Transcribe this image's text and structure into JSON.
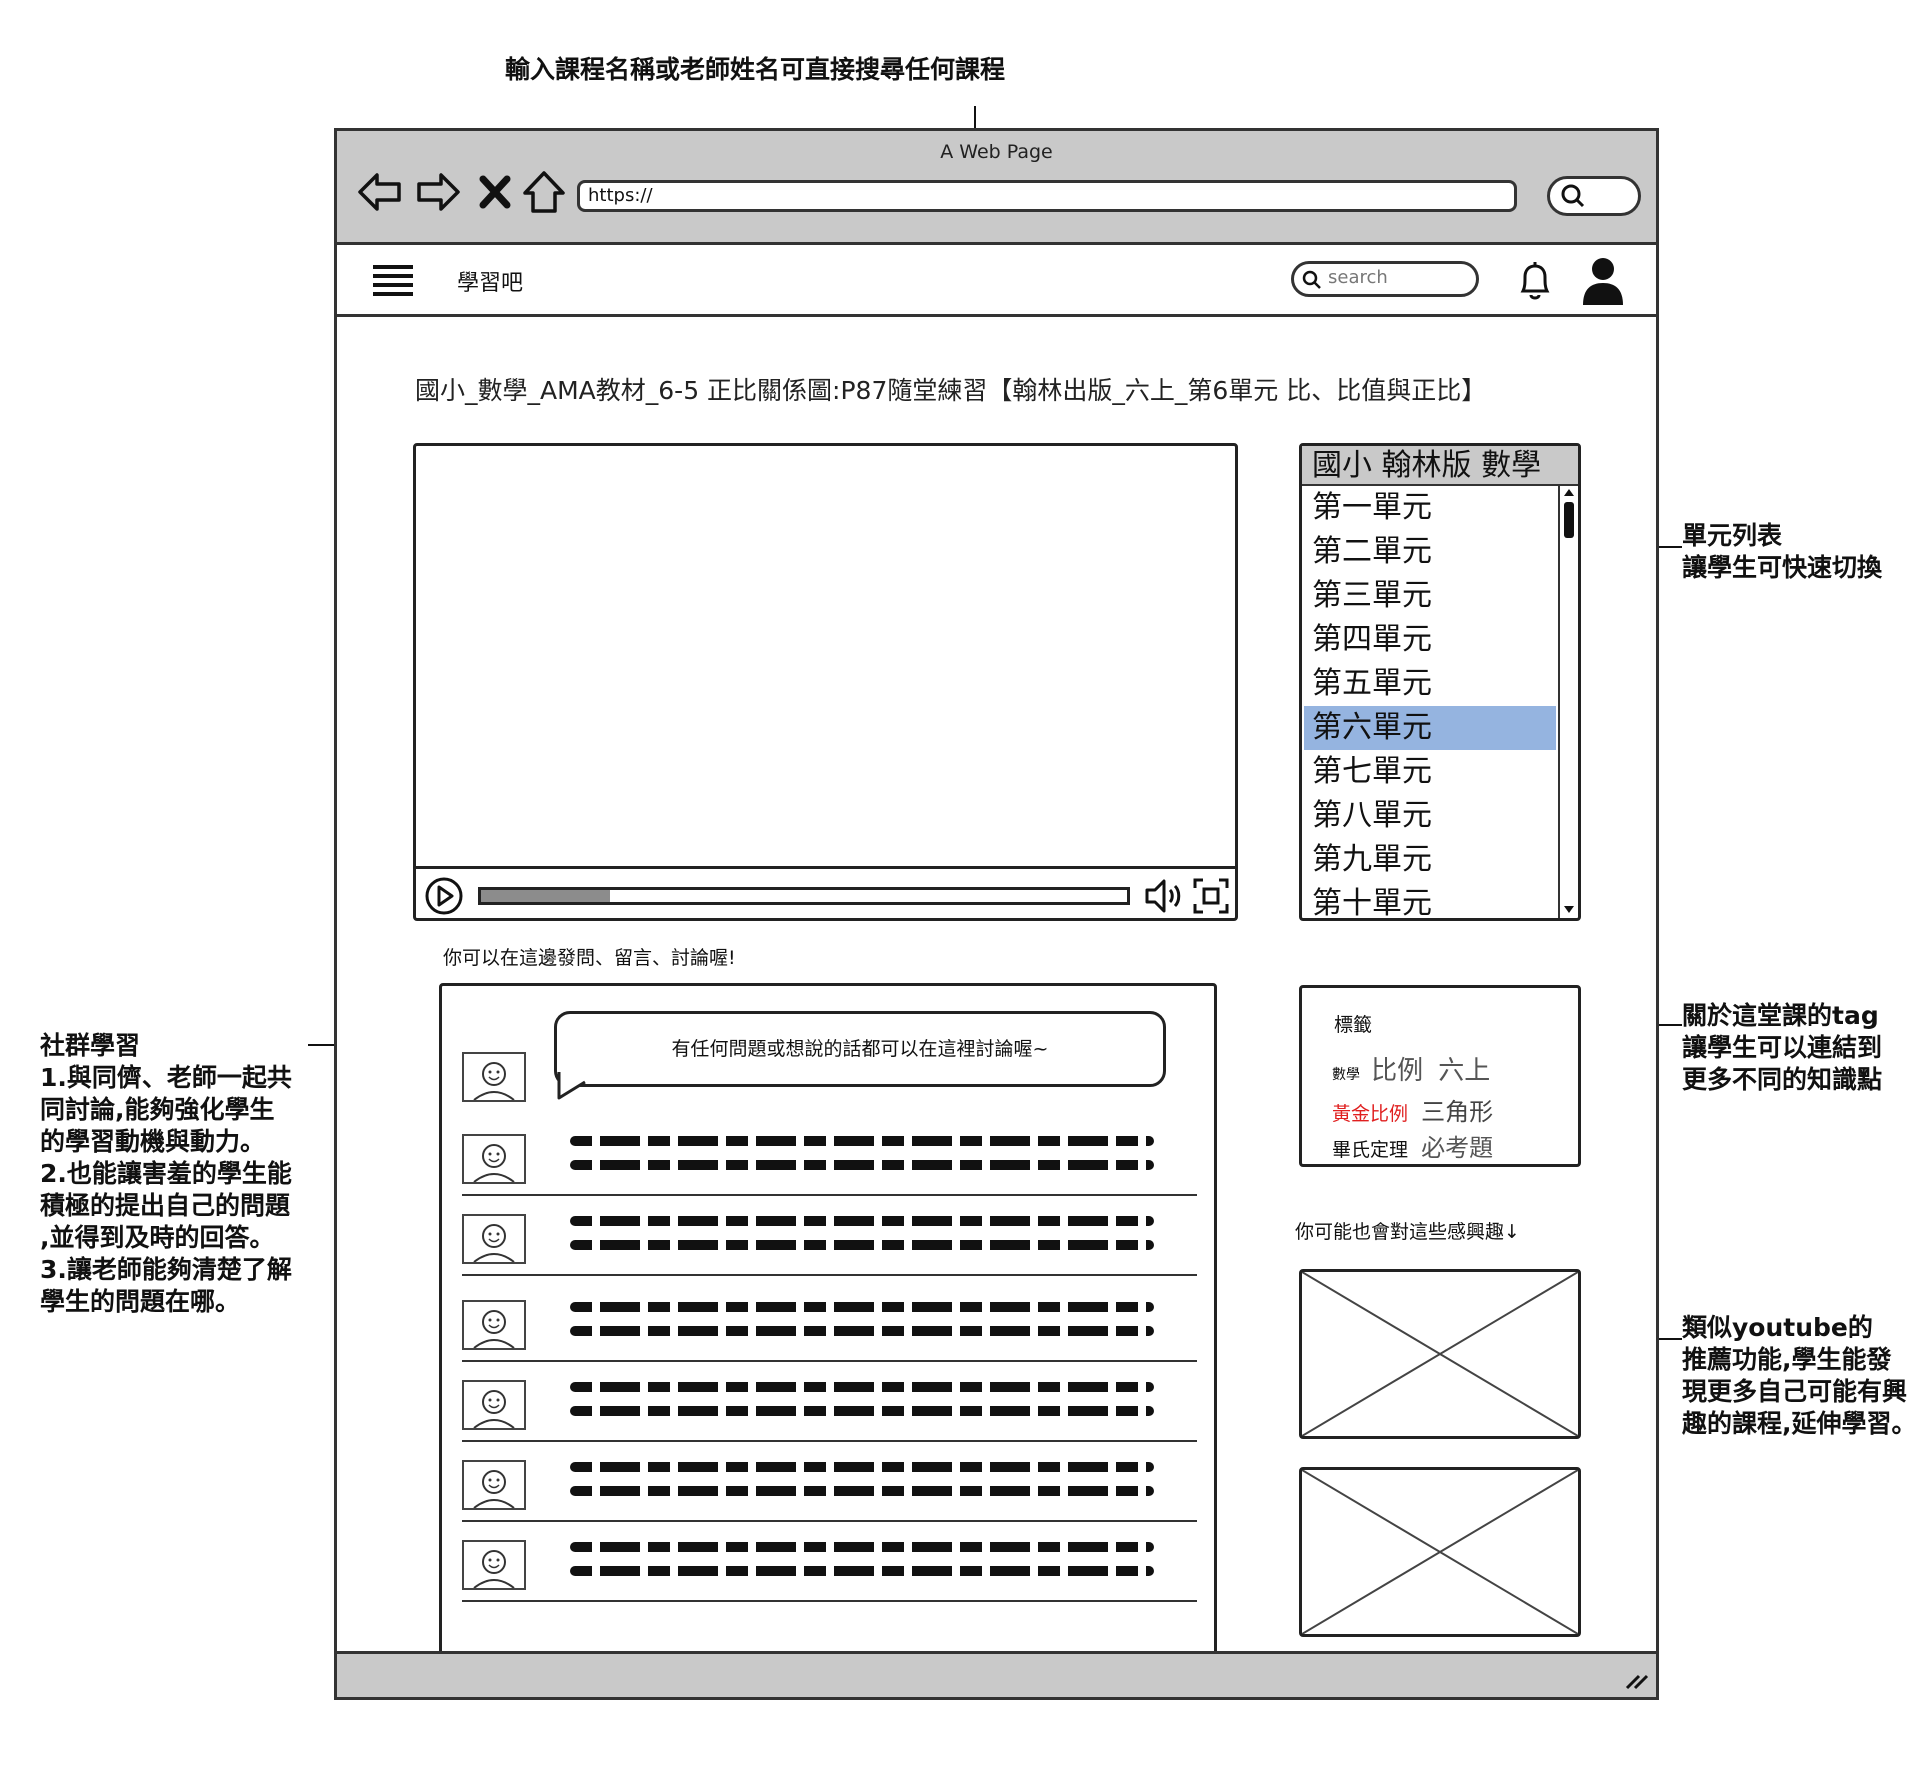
{
  "annotations": {
    "search_note": "輸入課程名稱或老師姓名可直接搜尋任何課程",
    "unit_note": "單元列表\n讓學生可快速切換",
    "tag_note": "關於這堂課的tag\n讓學生可以連結到\n更多不同的知識點",
    "recommend_note": "類似youtube的\n推薦功能,學生能發\n現更多自己可能有興\n趣的課程,延伸學習。",
    "social_note": "社群學習\n1.與同儕、老師一起共\n同討論,能夠強化學生\n的學習動機與動力。\n2.也能讓害羞的學生能\n積極的提出自己的問題\n,並得到及時的回答。\n3.讓老師能夠清楚了解\n學生的問題在哪。"
  },
  "browser": {
    "window_title": "A Web Page",
    "url": "https://"
  },
  "appbar": {
    "brand": "學習吧",
    "search_placeholder": "search"
  },
  "course": {
    "title": "國小_數學_AMA教材_6-5 正比關係圖:P87隨堂練習【翰林出版_六上_第6單元 比、比值與正比】"
  },
  "video": {
    "progress": 0.2
  },
  "unit_list": {
    "header": "國小 翰林版 數學",
    "items": [
      "第一單元",
      "第二單元",
      "第三單元",
      "第四單元",
      "第五單元",
      "第六單元",
      "第七單元",
      "第八單元",
      "第九單元",
      "第十單元"
    ],
    "selected_index": 5
  },
  "discussion": {
    "hint": "你可以在這邊發問、留言、討論喔!",
    "bubble_text": "有任何問題或想說的話都可以在這裡討論喔~"
  },
  "tags": {
    "heading": "標籤",
    "items": [
      "數學",
      "比例",
      "六上",
      "黃金比例",
      "三角形",
      "畢氏定理",
      "必考題"
    ],
    "highlight_color": "#e02020"
  },
  "recommendations": {
    "hint": "你可能也會對這些感興趣↓"
  }
}
